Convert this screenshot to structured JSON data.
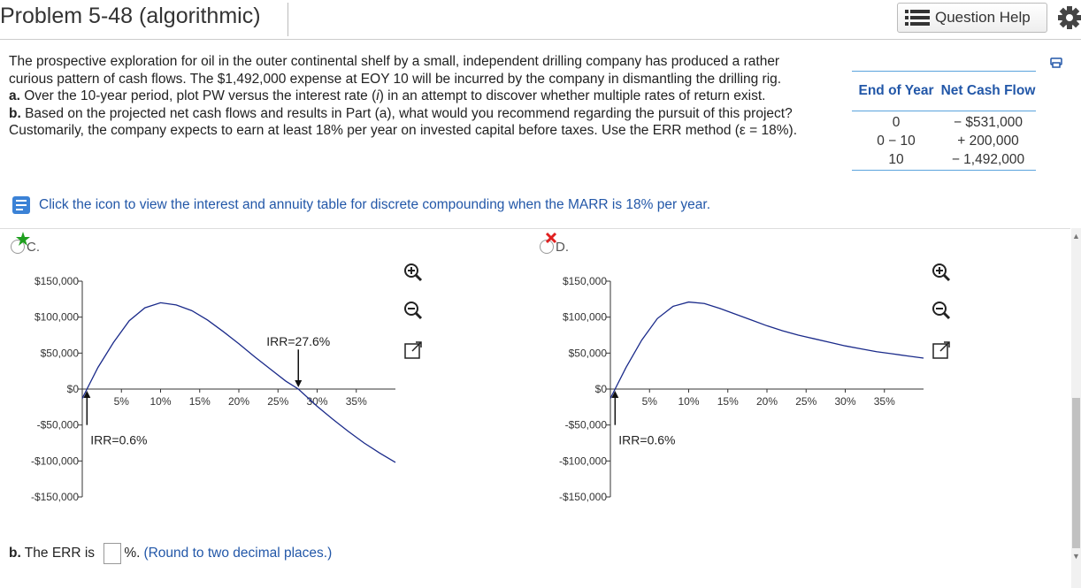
{
  "header": {
    "title": "Problem 5-48 (algorithmic)",
    "question_help": "Question Help",
    "icons": [
      "list-icon",
      "gear-icon"
    ]
  },
  "problem": {
    "intro": "The prospective exploration for oil in the outer continental shelf by a small, independent drilling company has produced a rather curious pattern of cash flows. The $1,492,000 expense at EOY 10 will be incurred by the company in dismantling the drilling rig.",
    "part_a_label": "a.",
    "part_a_text_1": " Over the 10-year period, plot PW versus the interest rate (",
    "part_a_i": "i",
    "part_a_text_2": ") in an attempt to discover whether multiple rates of return exist.",
    "part_b_label": "b.",
    "part_b_text": " Based on the projected net cash flows and results in Part (a), what would you recommend regarding the pursuit of this project? Customarily, the company expects to earn at least 18% per year on invested capital before taxes. Use the ERR method (ε = 18%)."
  },
  "cash_flow_table": {
    "headers": [
      "End of Year",
      "Net Cash Flow"
    ],
    "rows": [
      [
        "0",
        "− $531,000"
      ],
      [
        "0 − 10",
        "+ 200,000"
      ],
      [
        "10",
        "− 1,492,000"
      ]
    ]
  },
  "table_link": "Click the icon to view the interest and annuity table for discrete compounding when the MARR is 18% per year.",
  "options": [
    {
      "label": "C.",
      "status": "correct"
    },
    {
      "label": "D.",
      "status": "incorrect"
    }
  ],
  "chart_data": [
    {
      "type": "line",
      "option": "C.",
      "xlabel": "",
      "ylabel": "",
      "x_ticks": [
        "5%",
        "10%",
        "15%",
        "20%",
        "25%",
        "30%",
        "35%"
      ],
      "y_ticks": [
        "$150,000",
        "$100,000",
        "$50,000",
        "$0",
        "-$50,000",
        "-$100,000",
        "-$150,000"
      ],
      "xlim": [
        0,
        40
      ],
      "ylim": [
        -150000,
        150000
      ],
      "series": [
        {
          "x": [
            0,
            0.6,
            2,
            4,
            6,
            8,
            10,
            12,
            14,
            16,
            18,
            20,
            22,
            24,
            26,
            27.6,
            30,
            32,
            34,
            36,
            38,
            40
          ],
          "y": [
            -13000,
            0,
            30000,
            65000,
            95000,
            113000,
            120000,
            117000,
            109000,
            96000,
            80000,
            63000,
            45000,
            28000,
            11000,
            0,
            -24000,
            -42000,
            -59000,
            -75000,
            -89000,
            -102000
          ]
        }
      ],
      "annotations": [
        "IRR=0.6%",
        "IRR=27.6%"
      ],
      "grid": false
    },
    {
      "type": "line",
      "option": "D.",
      "xlabel": "",
      "ylabel": "",
      "x_ticks": [
        "5%",
        "10%",
        "15%",
        "20%",
        "25%",
        "30%",
        "35%"
      ],
      "y_ticks": [
        "$150,000",
        "$100,000",
        "$50,000",
        "$0",
        "-$50,000",
        "-$100,000",
        "-$150,000"
      ],
      "xlim": [
        0,
        40
      ],
      "ylim": [
        -150000,
        150000
      ],
      "series": [
        {
          "x": [
            0,
            0.6,
            2,
            4,
            6,
            8,
            10,
            12,
            14,
            16,
            18,
            20,
            22,
            24,
            26,
            28,
            30,
            32,
            34,
            36,
            38,
            40
          ],
          "y": [
            -13000,
            0,
            30000,
            68000,
            98000,
            115000,
            121000,
            119000,
            112000,
            104000,
            96000,
            88000,
            81000,
            75000,
            70000,
            65000,
            60000,
            56000,
            52000,
            49000,
            46000,
            43000
          ]
        }
      ],
      "annotations": [
        "IRR=0.6%"
      ],
      "grid": false
    }
  ],
  "err_question": {
    "label": "b.",
    "text": " The ERR is ",
    "value": "",
    "suffix": "%.",
    "note": "(Round to two decimal places.)"
  }
}
